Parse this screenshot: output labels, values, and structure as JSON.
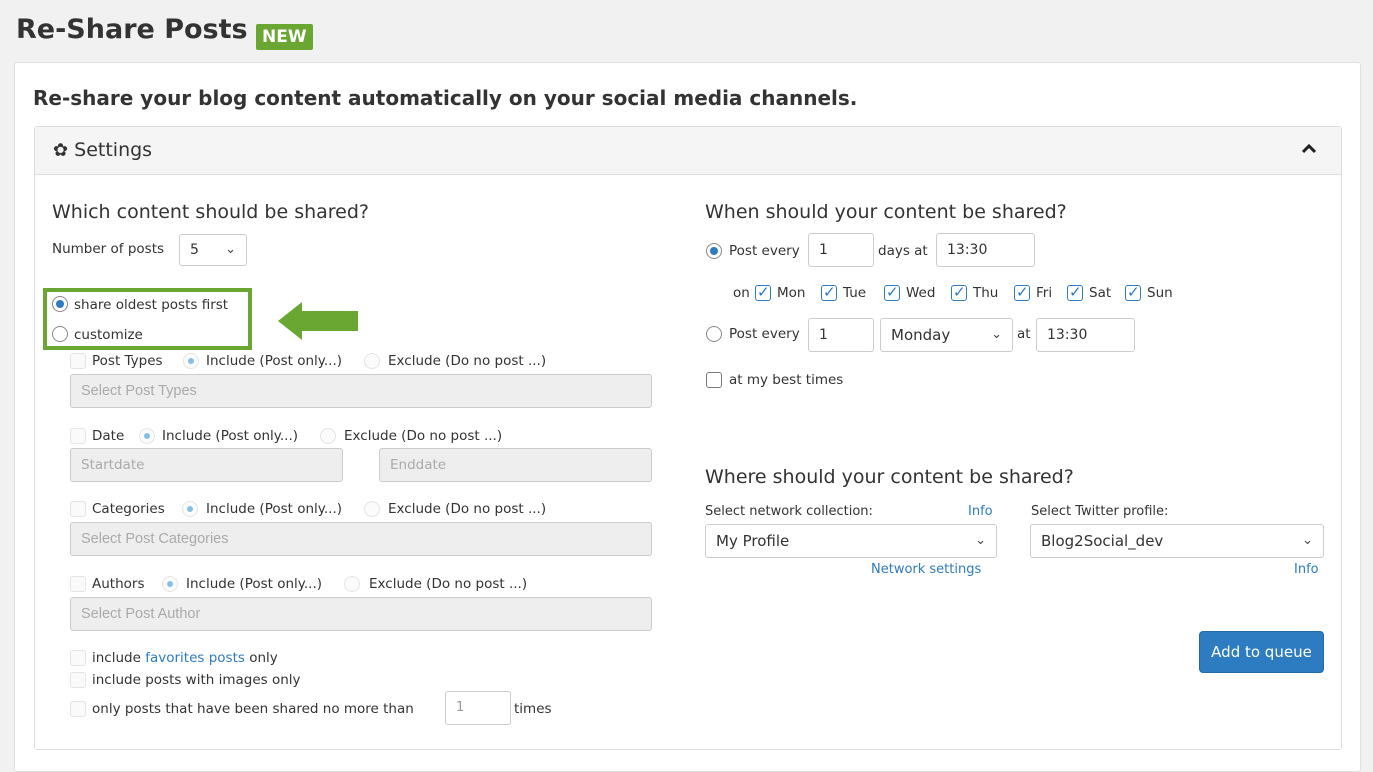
{
  "header": {
    "title": "Re-Share Posts",
    "badge": "NEW"
  },
  "subtitle": "Re-share your blog content automatically on your social media channels.",
  "settings": {
    "title": "Settings",
    "icon": "gear-icon",
    "collapse_icon": "chevron-up-icon"
  },
  "content": {
    "heading": "Which content should be shared?",
    "number_of_posts_label": "Number of posts",
    "number_of_posts_value": "5",
    "option_oldest": "share oldest posts first",
    "option_customize": "customize",
    "selected_option": "oldest",
    "include_label": "Include (Post only...)",
    "exclude_label": "Exclude (Do no post ...)",
    "post_types": {
      "label": "Post Types",
      "placeholder": "Select Post Types"
    },
    "date": {
      "label": "Date",
      "start_placeholder": "Startdate",
      "end_placeholder": "Enddate"
    },
    "categories": {
      "label": "Categories",
      "placeholder": "Select Post Categories"
    },
    "authors": {
      "label": "Authors",
      "placeholder": "Select Post Author"
    },
    "favorites_prefix": "include",
    "favorites_link": "favorites posts",
    "favorites_suffix": "only",
    "images_only": "include posts with images only",
    "shared_limit_prefix": "only posts that have been shared no more than",
    "shared_limit_value": "1",
    "shared_limit_suffix": "times"
  },
  "schedule": {
    "heading": "When should your content be shared?",
    "post_every_label": "Post every",
    "days_value": "1",
    "days_at_label": "days at",
    "time_value": "13:30",
    "on_label": "on",
    "days": [
      "Mon",
      "Tue",
      "Wed",
      "Thu",
      "Fri",
      "Sat",
      "Sun"
    ],
    "weekly_value": "1",
    "weekday_value": "Monday",
    "at_label": "at",
    "weekly_time_value": "13:30",
    "best_times_label": "at my best times"
  },
  "where": {
    "heading": "Where should your content be shared?",
    "network_label": "Select network collection:",
    "info_label": "Info",
    "network_value": "My Profile",
    "network_settings_link": "Network settings",
    "twitter_label": "Select Twitter profile:",
    "twitter_value": "Blog2Social_dev",
    "twitter_info": "Info"
  },
  "actions": {
    "add_to_queue": "Add to queue"
  },
  "colors": {
    "accent_green": "#6aa632",
    "primary_blue": "#2d7bc1"
  }
}
